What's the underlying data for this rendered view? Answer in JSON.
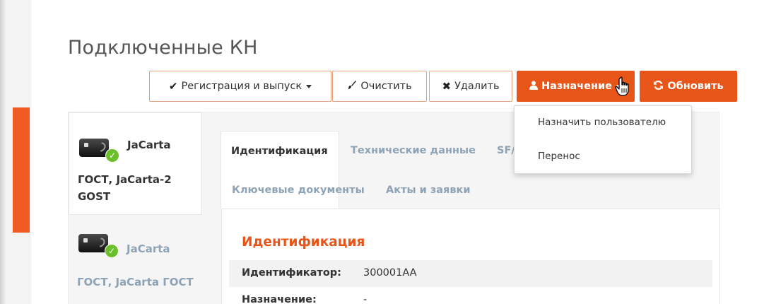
{
  "page": {
    "title": "Подключенные КН"
  },
  "toolbar": {
    "register_label": "Регистрация и выпуск",
    "clear_label": "Очистить",
    "delete_label": "Удалить",
    "assign_label": "Назначение",
    "refresh_label": "Обновить"
  },
  "dropdown": {
    "items": [
      {
        "label": "Назначить пользователю"
      },
      {
        "label": "Перенос"
      }
    ]
  },
  "cards": [
    {
      "title_a": "JaCarta",
      "title_b": "ГОСТ, JaCarta-2 GOST",
      "active": true
    },
    {
      "title_a": "JaCarta",
      "title_b": "ГОСТ, JaCarta ГОСТ",
      "active": false
    }
  ],
  "tabs": [
    {
      "label": "Идентификация",
      "active": true
    },
    {
      "label": "Технические данные",
      "active": false
    },
    {
      "label": "SF/",
      "active": false
    },
    {
      "label": "Ключевые документы",
      "active": false
    },
    {
      "label": "Акты и заявки",
      "active": false
    }
  ],
  "section": {
    "title": "Идентификация",
    "rows": [
      {
        "label": "Идентификатор:",
        "value": "300001AA"
      },
      {
        "label": "Назначение:",
        "value": "-"
      }
    ]
  },
  "icons": {
    "register": "check-icon",
    "clear": "brush-icon",
    "delete": "x-icon",
    "assign": "user-icon",
    "refresh": "refresh-icon",
    "card": "smart-card-icon",
    "status": "check-circle-icon"
  },
  "colors": {
    "accent": "#e85518",
    "strip": "#ef5b22",
    "success": "#6bbf2a",
    "muted_text": "#8ea3b5"
  }
}
